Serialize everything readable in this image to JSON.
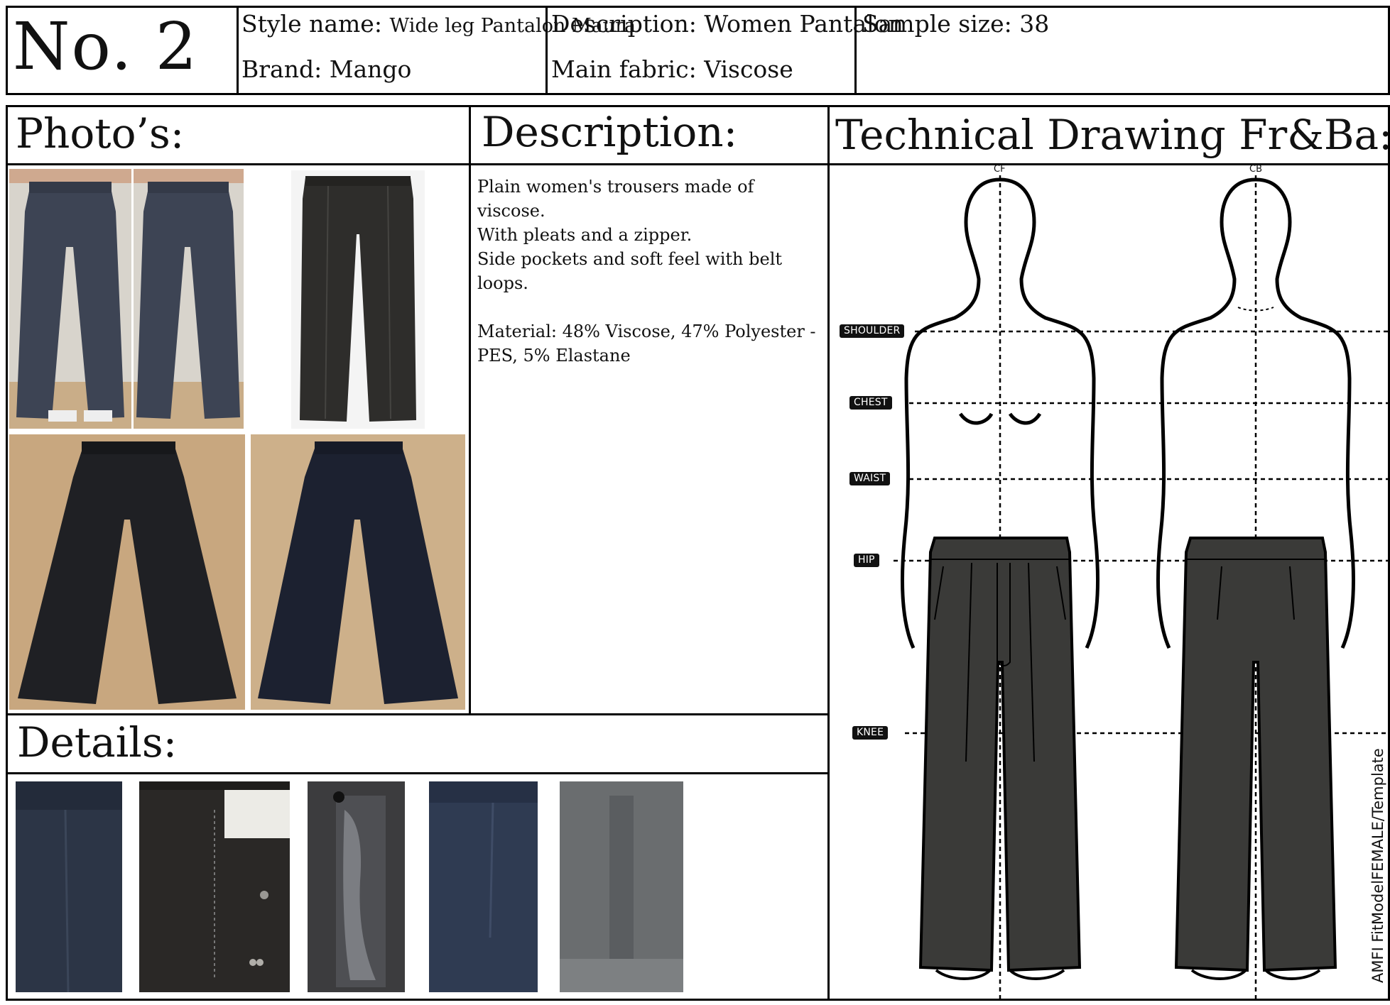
{
  "header": {
    "number": "No. 2",
    "style_name_label": "Style name:",
    "style_name_value": "Wide leg Pantalon Maura",
    "brand_label": "Brand:",
    "brand_value": "Mango",
    "description_label": "Description:",
    "description_value": "Women Pantalon",
    "main_fabric_label": "Main fabric:",
    "main_fabric_value": "Viscose",
    "sample_size_label": "Sample size:",
    "sample_size_value": "38"
  },
  "sections": {
    "photos": "Photo’s:",
    "description": "Description:",
    "technical": "Technical Drawing Fr&Ba:",
    "details": "Details:"
  },
  "description_body": {
    "line1": "Plain women's trousers made of viscose.",
    "line2": "With pleats and a zipper.",
    "line3": "Side pockets and soft feel with belt loops.",
    "material1": "Material: 48% Viscose, 47% Polyester -",
    "material2": "PES, 5% Elastane"
  },
  "technical_drawing": {
    "front_label": "CF",
    "back_label": "CB",
    "measure_lines": [
      "SHOULDER",
      "CHEST",
      "WAIST",
      "HIP",
      "KNEE"
    ],
    "template_credit": "AMFI FitModelFEMALE/Template"
  },
  "colors": {
    "border": "#000000",
    "garment": "#3a3a38",
    "navy": "#2b3547",
    "floor": "#c9ad88"
  }
}
